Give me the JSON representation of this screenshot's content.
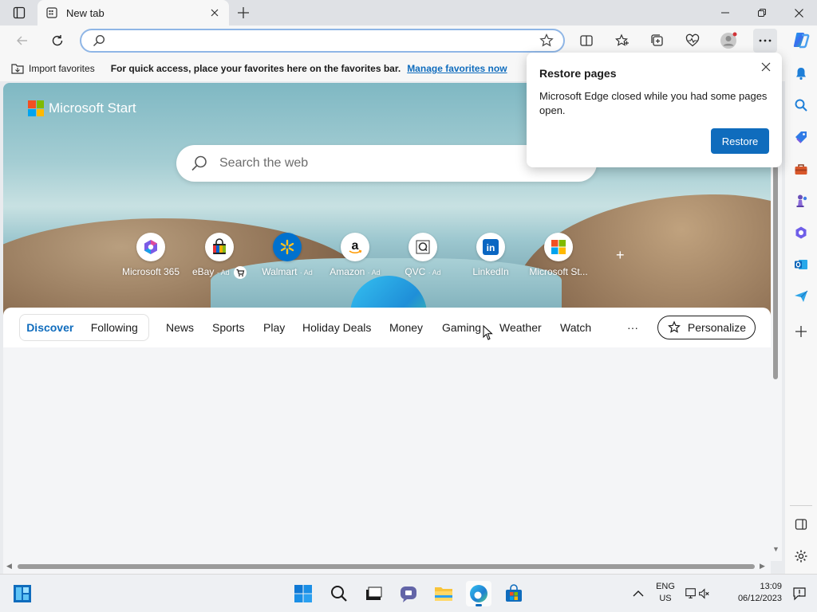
{
  "browser": {
    "tab_title": "New tab",
    "address_value": "",
    "address_placeholder": ""
  },
  "favorites_bar": {
    "import_label": "Import favorites",
    "message": "For quick access, place your favorites here on the favorites bar.",
    "manage_link": "Manage favorites now"
  },
  "start_page": {
    "brand": "Microsoft Start",
    "search_placeholder": "Search the web",
    "quick_links": [
      {
        "label": "Microsoft 365",
        "ad": ""
      },
      {
        "label": "eBay",
        "ad": "· Ad"
      },
      {
        "label": "Walmart",
        "ad": "· Ad"
      },
      {
        "label": "Amazon",
        "ad": "· Ad"
      },
      {
        "label": "QVC",
        "ad": "· Ad"
      },
      {
        "label": "LinkedIn",
        "ad": ""
      },
      {
        "label": "Microsoft St...",
        "ad": ""
      }
    ],
    "add_symbol": "+",
    "nav": {
      "discover": "Discover",
      "following": "Following",
      "items": [
        "News",
        "Sports",
        "Play",
        "Holiday Deals",
        "Money",
        "Gaming",
        "Weather",
        "Watch"
      ],
      "more": "···",
      "personalize": "Personalize"
    }
  },
  "popup": {
    "title": "Restore pages",
    "message": "Microsoft Edge closed while you had some pages open.",
    "button": "Restore"
  },
  "taskbar": {
    "lang_top": "ENG",
    "lang_bottom": "US",
    "time": "13:09",
    "date": "06/12/2023"
  },
  "colors": {
    "accent": "#0f6cbd",
    "chrome": "#f7f7f7",
    "titlebar": "#dfe1e5"
  }
}
